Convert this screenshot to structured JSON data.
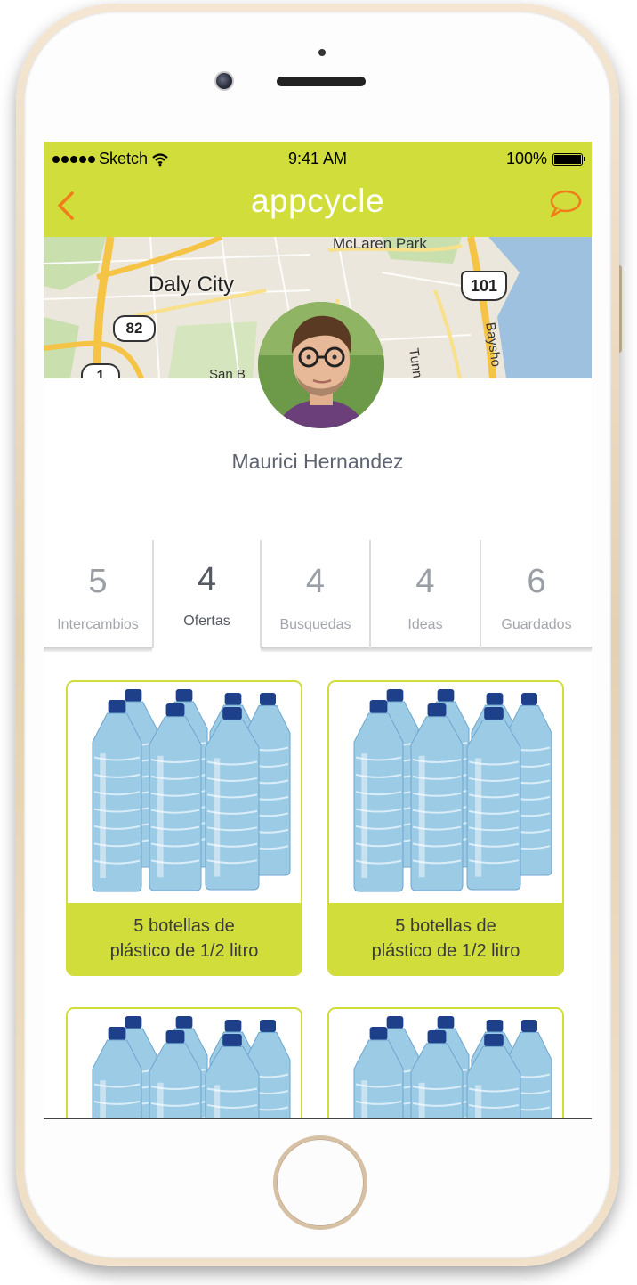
{
  "status_bar": {
    "carrier": "Sketch",
    "time": "9:41 AM",
    "battery": "100%"
  },
  "header": {
    "brand": "appcycle",
    "back_icon": "chevron-left-icon",
    "chat_icon": "speech-bubble-icon"
  },
  "map": {
    "labels": [
      "McLaren Park",
      "Daly City",
      "82",
      "101",
      "Tunnel Av",
      "Baysho",
      "San B",
      "1"
    ]
  },
  "profile": {
    "name": "Maurici Hernandez"
  },
  "tabs": [
    {
      "count": "5",
      "label": "Intercambios"
    },
    {
      "count": "4",
      "label": "Ofertas"
    },
    {
      "count": "4",
      "label": "Busquedas"
    },
    {
      "count": "4",
      "label": "Ideas"
    },
    {
      "count": "6",
      "label": "Guardados"
    }
  ],
  "active_tab": "Ofertas",
  "offers": [
    {
      "line1": "5 botellas de",
      "line2": "plástico de 1/2 litro"
    },
    {
      "line1": "5 botellas de",
      "line2": "plástico de 1/2 litro"
    },
    {
      "line1": "",
      "line2": ""
    },
    {
      "line1": "",
      "line2": ""
    }
  ],
  "colors": {
    "accent": "#d0dd3b",
    "orange": "#f07c1a",
    "text": "#5d6470"
  }
}
